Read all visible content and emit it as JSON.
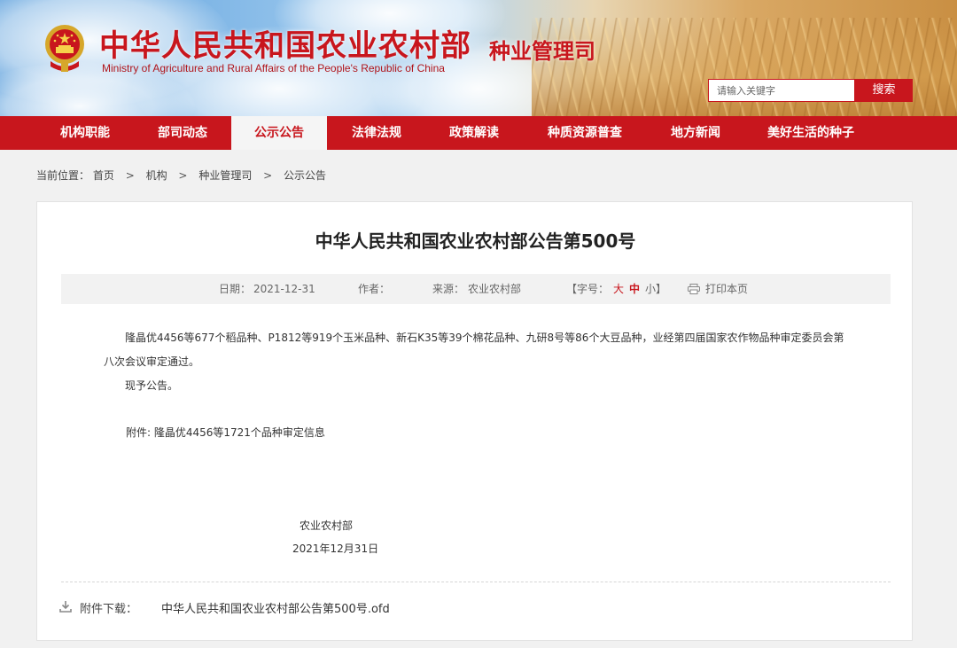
{
  "header": {
    "site_title": "中华人民共和国农业农村部",
    "site_subtitle": "Ministry of Agriculture and Rural Affairs of the People's Republic of China",
    "dept_name": "种业管理司",
    "search_placeholder": "请输入关键字",
    "search_button": "搜索",
    "emblem_icon": "national-emblem-icon",
    "accent_color": "#c8161d"
  },
  "nav": {
    "items": [
      {
        "label": "机构职能"
      },
      {
        "label": "部司动态"
      },
      {
        "label": "公示公告",
        "active": true
      },
      {
        "label": "法律法规"
      },
      {
        "label": "政策解读"
      },
      {
        "label": "种质资源普查"
      },
      {
        "label": "地方新闻"
      },
      {
        "label": "美好生活的种子"
      }
    ]
  },
  "breadcrumb": {
    "prefix": "当前位置：",
    "items": [
      "首页",
      "机构",
      "种业管理司",
      "公示公告"
    ],
    "separator": ">"
  },
  "article": {
    "title": "中华人民共和国农业农村部公告第500号",
    "meta": {
      "date_label": "日期：",
      "date": "2021-12-31",
      "author_label": "作者：",
      "source_label": "来源：",
      "source": "农业农村部",
      "font_label": "【字号：",
      "font_big": "大",
      "font_mid": "中",
      "font_small": "小】",
      "print": "打印本页",
      "print_icon": "printer-icon"
    },
    "paragraph_1": "隆晶优4456等677个稻品种、P1812等919个玉米品种、新石K35等39个棉花品种、九研8号等86个大豆品种，业经第四届国家农作物品种审定委员会第八次会议审定通过。",
    "paragraph_2": "现予公告。",
    "attachment_line": "附件: 隆晶优4456等1721个品种审定信息",
    "sign_org": "农业农村部",
    "sign_date": "2021年12月31日",
    "download_label": "附件下载：",
    "download_file": "中华人民共和国农业农村部公告第500号.ofd",
    "download_icon": "download-icon"
  }
}
